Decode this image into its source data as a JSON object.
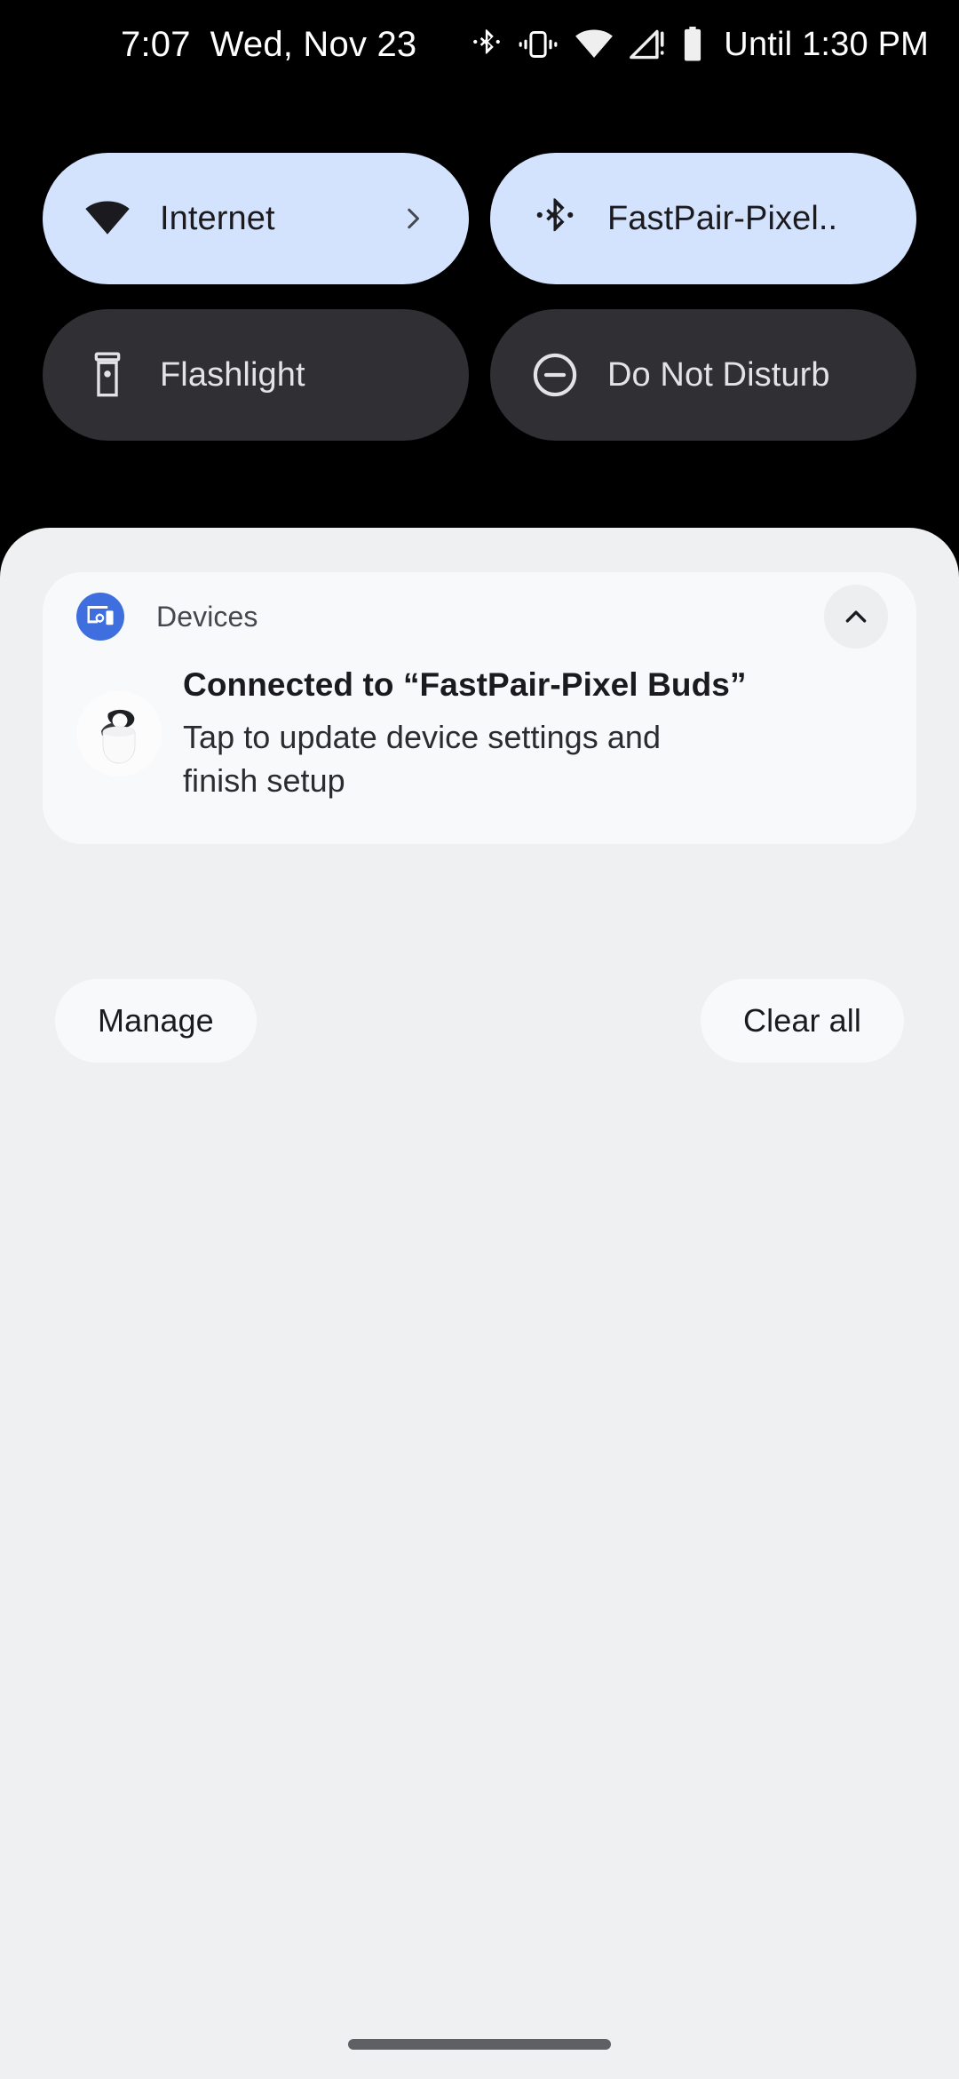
{
  "status_bar": {
    "clock": "7:07",
    "date": "Wed, Nov 23",
    "battery_estimate": "Until 1:30 PM",
    "icons": [
      {
        "name": "bluetooth-icon"
      },
      {
        "name": "vibrate-icon"
      },
      {
        "name": "wifi-icon"
      },
      {
        "name": "signal-no-sim-icon"
      },
      {
        "name": "battery-icon"
      }
    ]
  },
  "quick_settings": {
    "tiles": [
      {
        "label": "Internet",
        "icon": "wifi-icon",
        "state": "active",
        "has_chevron": true
      },
      {
        "label": "FastPair-Pixel..",
        "icon": "bluetooth-icon",
        "state": "active",
        "has_chevron": false
      },
      {
        "label": "Flashlight",
        "icon": "flashlight-icon",
        "state": "inactive",
        "has_chevron": false
      },
      {
        "label": "Do Not Disturb",
        "icon": "do-not-disturb-icon",
        "state": "inactive",
        "has_chevron": false
      }
    ]
  },
  "notification": {
    "app_name": "Devices",
    "app_icon": "devices-icon",
    "collapse_icon": "chevron-up-icon",
    "thumbnail": "pixel-buds-case-image",
    "title": "Connected to “FastPair-Pixel Buds”",
    "description": "Tap to update device settings and finish setup"
  },
  "actions": {
    "manage_label": "Manage",
    "clear_all_label": "Clear all"
  },
  "nav": {
    "home_handle": "home-gesture-handle"
  },
  "colors": {
    "tile_active_bg": "#D3E3FD",
    "tile_inactive_bg": "#303034",
    "shade_bg": "#EFF0F2",
    "card_bg": "#F8F9FB",
    "app_icon_bg": "#3F6FDE",
    "text_primary": "#1B1B1F",
    "status_bar_bg": "#000000"
  }
}
